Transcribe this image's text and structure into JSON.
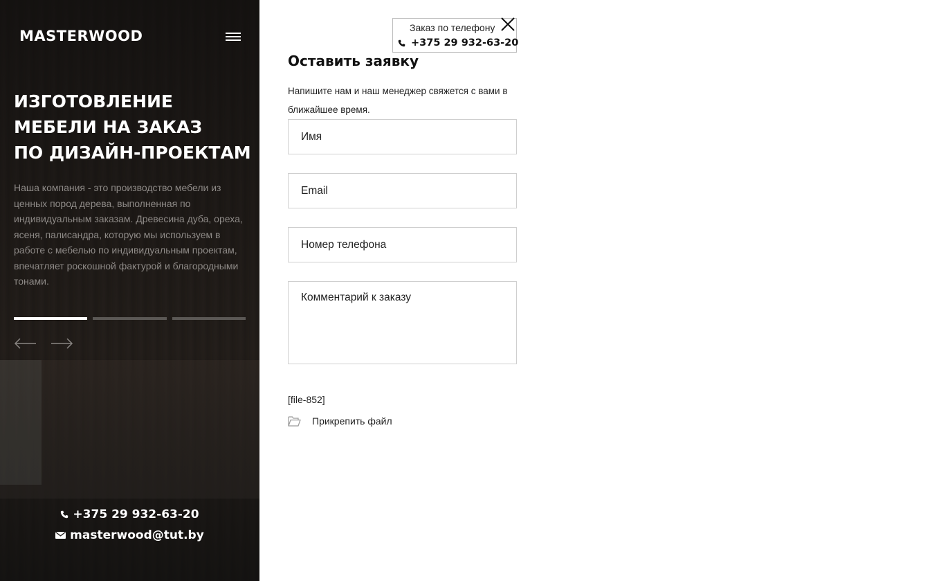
{
  "brand": {
    "logo_text": "MASTERWOOD"
  },
  "hero": {
    "title_lines": [
      "ИЗГОТОВЛЕНИЕ",
      "МЕБЕЛИ НА ЗАКАЗ",
      "ПО ДИЗАЙН-ПРОЕКТАМ"
    ],
    "description": "Наша компания - это производство мебели из ценных пород дерева, выполненная по индивидуальным заказам. Древесина дуба, ореха, ясеня, палисандра, которую мы используем в работе с мебелью по индивидуальным проектам, впечатляет роскошной фактурой и благородными тонами.",
    "slides_total": 3,
    "slide_active": 1
  },
  "contacts": {
    "phone": "+375 29 932-63-20",
    "email": "masterwood@tut.by"
  },
  "phone_order": {
    "label": "Заказ по телефону",
    "phone": "+375 29 932-63-20"
  },
  "form": {
    "title": "Оставить заявку",
    "description": "Напишите нам и наш менеджер свяжется с вами в ближайшее время.",
    "name_placeholder": "Имя",
    "email_placeholder": "Email",
    "phone_placeholder": "Номер телефона",
    "comment_placeholder": "Комментарий к заказу",
    "file_code": "[file-852]",
    "attach_label": "Прикрепить файл"
  },
  "icons": {
    "menu": "menu-icon",
    "prev": "arrow-left-icon",
    "next": "arrow-right-icon",
    "phone": "phone-icon",
    "email": "envelope-icon",
    "close": "close-icon",
    "folder": "folder-open-icon"
  },
  "colors": {
    "panel_bg": "#1e1a17",
    "accent_text": "#ffffff",
    "muted_text": "#8e8a87",
    "field_border": "#cfcfcf"
  }
}
